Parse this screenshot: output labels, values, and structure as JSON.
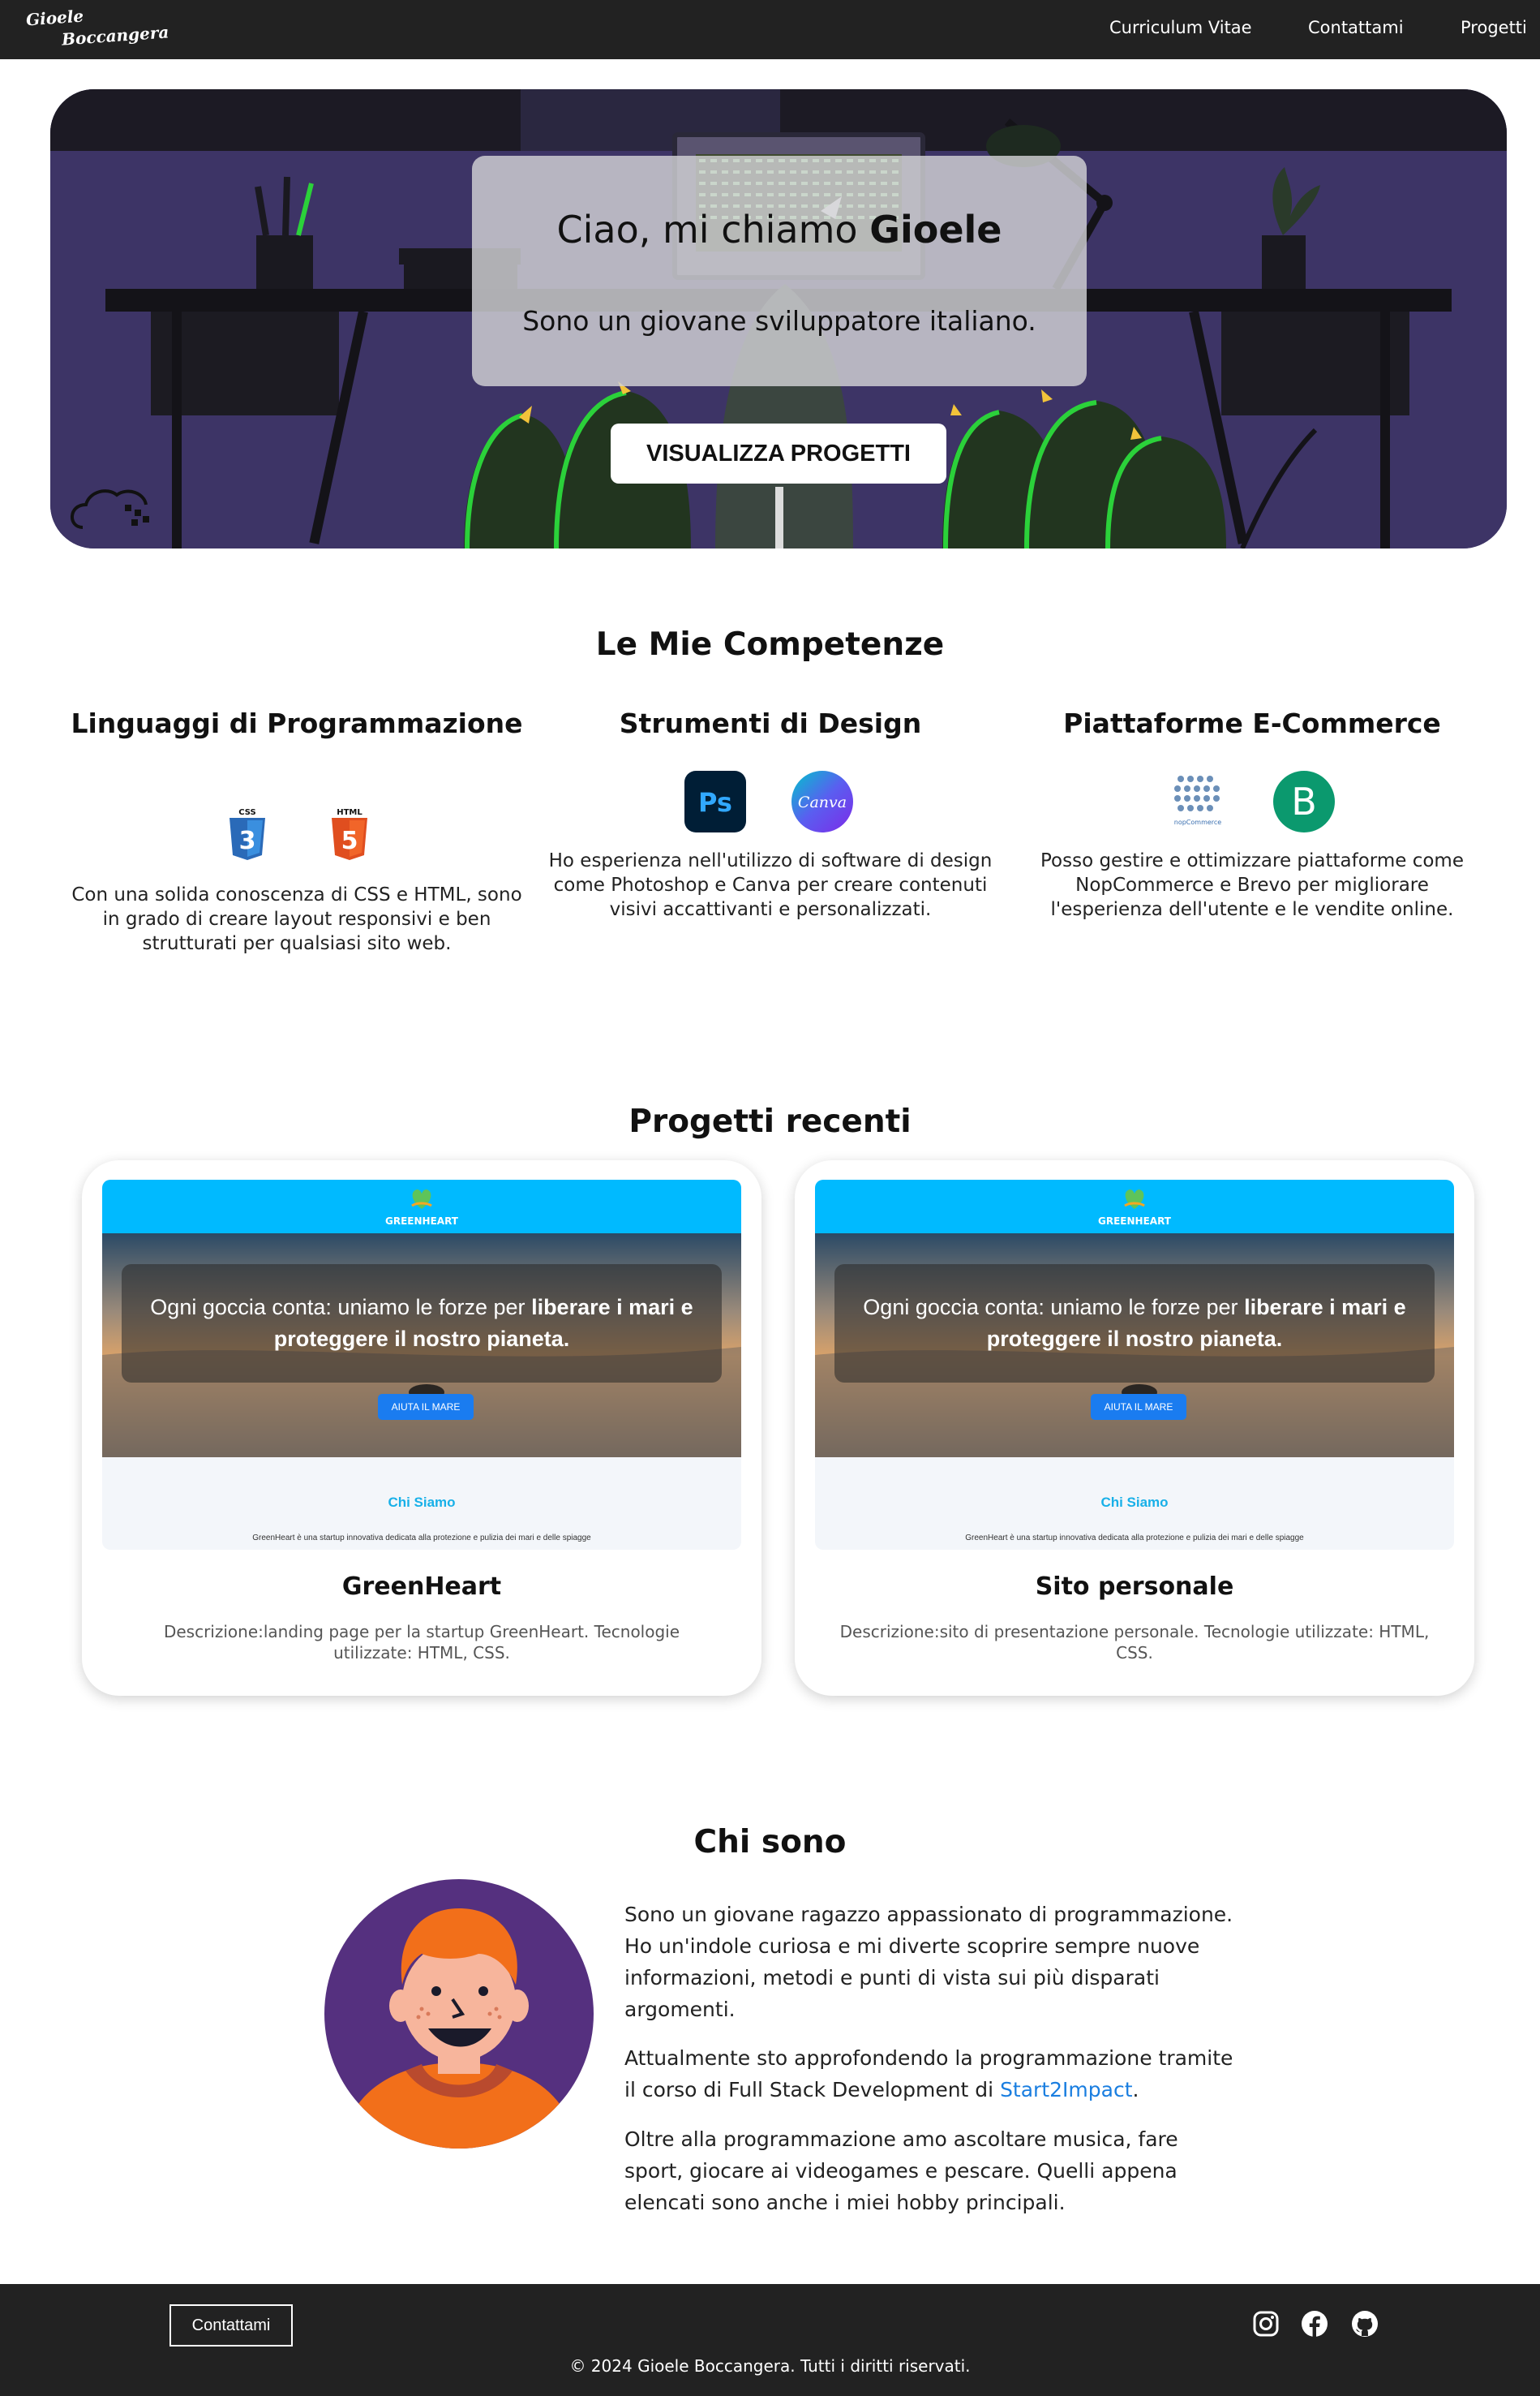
{
  "nav": {
    "logo_line1": "Gioele",
    "logo_line2": "Boccangera",
    "links": [
      "Curriculum Vitae",
      "Contattami",
      "Progetti"
    ]
  },
  "hero": {
    "greeting": "Ciao, mi chiamo ",
    "name": "Gioele",
    "subtitle": "Sono un giovane sviluppatore italiano.",
    "cta_label": "VISUALIZZA PROGETTI"
  },
  "skills": {
    "title": "Le Mie Competenze",
    "items": [
      {
        "title": "Linguaggi di Programmazione",
        "icons": [
          "css3-icon",
          "html5-icon"
        ],
        "icon_labels": [
          "CSS",
          "HTML"
        ],
        "text": "Con una solida conoscenza di CSS e HTML, sono in grado di creare layout responsivi e ben strutturati per qualsiasi sito web."
      },
      {
        "title": "Strumenti di Design",
        "icons": [
          "photoshop-icon",
          "canva-icon"
        ],
        "icon_labels": [
          "Ps",
          "Canva"
        ],
        "text": "Ho esperienza nell'utilizzo di software di design come Photoshop e Canva per creare contenuti visivi accattivanti e personalizzati."
      },
      {
        "title": "Piattaforme E-Commerce",
        "icons": [
          "nopcommerce-icon",
          "brevo-icon"
        ],
        "icon_labels": [
          "nopCommerce",
          "B"
        ],
        "text": "Posso gestire e ottimizzare piattaforme come NopCommerce e Brevo per migliorare l'esperienza dell'utente e le vendite online."
      }
    ]
  },
  "projects": {
    "title": "Progetti recenti",
    "preview": {
      "brand": "GREENHEART",
      "slogan_pre": "Ogni goccia conta: uniamo le forze per ",
      "slogan_bold1": "liberare i mari e",
      "slogan_bold2": "proteggere il nostro pianeta.",
      "button": "AIUTA IL MARE",
      "section": "Chi Siamo",
      "section_text": "GreenHeart è una startup innovativa dedicata alla protezione e pulizia dei mari e delle spiagge"
    },
    "items": [
      {
        "title": "GreenHeart",
        "description": "Descrizione:landing page per la startup GreenHeart. Tecnologie utilizzate: HTML, CSS."
      },
      {
        "title": "Sito personale",
        "description": "Descrizione:sito di presentazione personale. Tecnologie utilizzate: HTML, CSS."
      }
    ]
  },
  "about": {
    "title": "Chi sono",
    "p1": "Sono un giovane ragazzo appassionato di programmazione. Ho un'indole curiosa e mi diverte scoprire sempre nuove informazioni, metodi e punti di vista sui più disparati argomenti.",
    "p2_pre": "Attualmente sto approfondendo la programmazione tramite il corso di Full Stack Development di ",
    "p2_link": "Start2Impact",
    "p2_post": ".",
    "p3": "Oltre alla programmazione amo ascoltare musica, fare sport, giocare ai videogames e pescare. Quelli appena elencati sono anche i miei hobby principali."
  },
  "footer": {
    "contact_label": "Contattami",
    "social_icons": [
      "instagram-icon",
      "facebook-icon",
      "github-icon"
    ],
    "copyright": "© 2024 Gioele Boccangera. Tutti i diritti riservati."
  },
  "colors": {
    "nav_bg": "#222222",
    "hero_bg": "#3d3466",
    "accent_green": "#2bd13a",
    "link_blue": "#1a7ee0",
    "preview_blue": "#00baff"
  }
}
